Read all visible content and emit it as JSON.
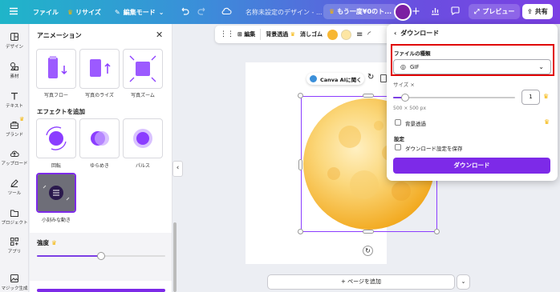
{
  "topbar": {
    "menu_icon": "hamburger-icon",
    "file": "ファイル",
    "resize": "リサイズ",
    "edit_mode": "編集モード",
    "title": "名称未設定のデザイン - ...",
    "promo": "もう一度¥0のト...",
    "preview": "プレビュー",
    "share": "共有"
  },
  "rail": {
    "items": [
      {
        "label": "デザイン",
        "icon": "layout-icon"
      },
      {
        "label": "素材",
        "icon": "shapes-icon"
      },
      {
        "label": "テキスト",
        "icon": "text-icon"
      },
      {
        "label": "ブランド",
        "icon": "brand-icon"
      },
      {
        "label": "アップロード",
        "icon": "upload-cloud-icon"
      },
      {
        "label": "ツール",
        "icon": "pen-tool-icon"
      },
      {
        "label": "プロジェクト",
        "icon": "folder-icon"
      },
      {
        "label": "アプリ",
        "icon": "apps-grid-icon"
      },
      {
        "label": "マジック生成",
        "icon": "magic-image-icon"
      }
    ]
  },
  "panel": {
    "title": "アニメーション",
    "tiles_top": [
      {
        "label": "写真フロー"
      },
      {
        "label": "写真のライズ"
      },
      {
        "label": "写真ズーム"
      }
    ],
    "effects_heading": "エフェクトを追加",
    "effects": [
      {
        "label": "回転"
      },
      {
        "label": "ゆらめき"
      },
      {
        "label": "パルス"
      }
    ],
    "selected_effect": {
      "label": "小刻みな動き"
    },
    "strength_label": "強度",
    "strength_value": 0.5
  },
  "context_toolbar": {
    "edit": "編集",
    "bg_remove": "背景透過",
    "eraser": "消しゴム",
    "colors": [
      "#f7b733",
      "#fde6a3"
    ]
  },
  "canvas": {
    "ai_button": "Canva AIに聞く",
    "add_page": "+ ページを追加"
  },
  "download": {
    "heading": "ダウンロード",
    "file_type_label": "ファイルの種類",
    "file_type_value": "GIF",
    "size_label": "サイズ ×",
    "size_value": "1",
    "size_dims": "500 × 500 px",
    "size_slider": 0.1,
    "transparent_bg": "背景透過",
    "settings_heading": "設定",
    "save_settings": "ダウンロード設定を保存",
    "button": "ダウンロード"
  },
  "colors": {
    "accent": "#7d2ae8",
    "highlight": "#e00000",
    "moon": "#f7b733"
  }
}
